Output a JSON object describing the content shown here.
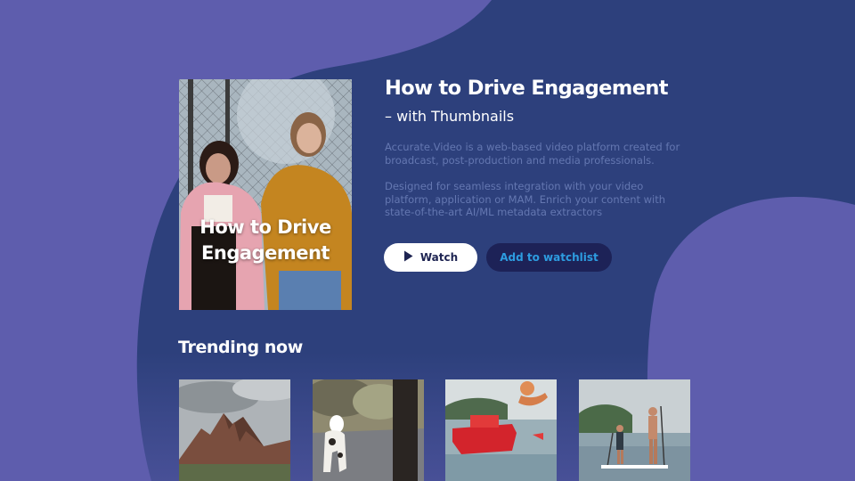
{
  "featured": {
    "poster_text": "How to Drive Engagement",
    "title": "How to Drive Engagement",
    "subtitle": "– with Thumbnails",
    "description_1": "Accurate.Video is a web-based video platform created for broadcast, post-production and media professionals.",
    "description_2": "Designed for seamless integration with your video platform, application or MAM. Enrich your content with state-of-the-art AI/ML metadata extractors"
  },
  "actions": {
    "watch_label": "Watch",
    "watch_icon": "play-icon",
    "watchlist_label": "Add to watchlist"
  },
  "trending": {
    "title": "Trending now",
    "items": [
      {
        "scene": "mountain peaks"
      },
      {
        "scene": "dog on road"
      },
      {
        "scene": "person on red boat"
      },
      {
        "scene": "paddleboarders"
      }
    ]
  },
  "colors": {
    "background": "#5e5dad",
    "blob": "#2d407c",
    "watchlist_button": "#1d2257",
    "watchlist_text": "#2d9ce0",
    "description_text": "#6477b1"
  }
}
